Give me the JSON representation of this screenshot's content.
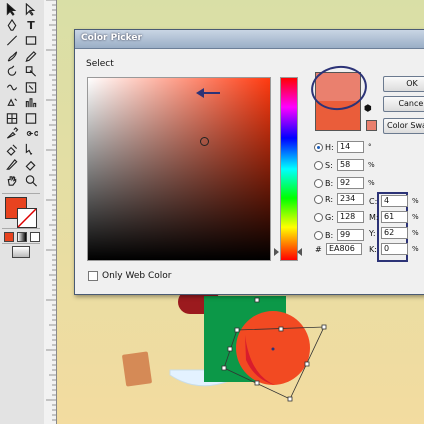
{
  "dialog": {
    "title": "Color Picker",
    "select_label": "Select",
    "only_web_color_label": "Only Web Color",
    "buttons": {
      "ok": "OK",
      "cancel": "Cancel",
      "swatches": "Color Swatches"
    }
  },
  "picker": {
    "new_color": "#ea806e",
    "current_color": "#ea5d3a",
    "hsb": [
      {
        "key": "H",
        "value": "14",
        "unit": "°",
        "selected": true
      },
      {
        "key": "S",
        "value": "58",
        "unit": "%",
        "selected": false
      },
      {
        "key": "B",
        "value": "92",
        "unit": "%",
        "selected": false
      }
    ],
    "rgb": [
      {
        "key": "R",
        "value": "234"
      },
      {
        "key": "G",
        "value": "128"
      },
      {
        "key": "B",
        "value": "99"
      }
    ],
    "cmyk": [
      {
        "key": "C",
        "value": "4",
        "unit": "%"
      },
      {
        "key": "M",
        "value": "61",
        "unit": "%"
      },
      {
        "key": "Y",
        "value": "62",
        "unit": "%"
      },
      {
        "key": "K",
        "value": "0",
        "unit": "%"
      }
    ],
    "hex_symbol": "#",
    "hex": "EA806"
  },
  "toolbar": {
    "tools": [
      "selection-tool",
      "direct-selection-tool",
      "pen-tool",
      "type-tool",
      "line-tool",
      "rectangle-tool",
      "paintbrush-tool",
      "pencil-tool",
      "rotate-tool",
      "scale-tool",
      "warp-tool",
      "free-transform-tool",
      "symbol-sprayer-tool",
      "column-graph-tool",
      "mesh-tool",
      "gradient-tool",
      "eyedropper-tool",
      "blend-tool",
      "live-paint-tool",
      "live-paint-selection-tool",
      "slice-tool",
      "eraser-tool",
      "hand-tool",
      "zoom-tool"
    ],
    "fill_color": "#e8431f",
    "stroke_color": "#ffffff",
    "type_glyph": "T"
  },
  "colors": {
    "accent_annotation": "#2c3377",
    "canvas_top": "#d9dfa6",
    "canvas_bottom": "#f3dca0"
  }
}
